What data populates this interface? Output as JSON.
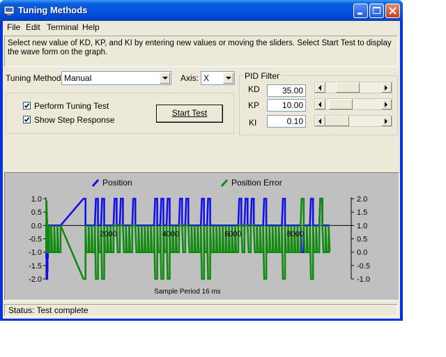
{
  "window": {
    "title": "Tuning Methods"
  },
  "menu": {
    "items": [
      "File",
      "Edit",
      "Terminal",
      "Help"
    ]
  },
  "instructions": "Select new value of KD, KP, and KI by entering new values or moving the sliders.  Select Start Test to display the wave form on the graph.",
  "tuning": {
    "method_label": "Tuning Method:",
    "method_value": "Manual",
    "axis_label": "Axis:",
    "axis_value": "X"
  },
  "test_options": {
    "perform_label": "Perform Tuning Test",
    "perform_checked": true,
    "step_label": "Show Step Response",
    "step_checked": true,
    "start_button": "Start Test"
  },
  "pid": {
    "title": "PID Filter",
    "params": [
      {
        "name": "KD",
        "value": "35.00",
        "slider_pos": 0.32
      },
      {
        "name": "KP",
        "value": "10.00",
        "slider_pos": 0.1
      },
      {
        "name": "KI",
        "value": "0.10",
        "slider_pos": 0.0
      }
    ]
  },
  "chart_data": {
    "type": "line",
    "xlabel": "Sample Period 16 ms",
    "x_ticks": [
      "2000",
      "4000",
      "6000",
      "8000"
    ],
    "xlim": [
      0,
      9300
    ],
    "left_axis": {
      "ticks": [
        "1.0",
        "0.5",
        "0.0",
        "-0.5",
        "-1.0",
        "-1.5",
        "-2.0"
      ],
      "ylim": [
        -2.0,
        1.0
      ]
    },
    "right_axis": {
      "ticks": [
        "2.0",
        "1.5",
        "1.0",
        "0.5",
        "0.0",
        "-0.5",
        "-1.0"
      ],
      "ylim": [
        -1.0,
        2.0
      ]
    },
    "legend_position": "top",
    "colors": {
      "Position": "#1010e8",
      "Position Error": "#128a12"
    },
    "series": [
      {
        "name": "Position",
        "axis": "left",
        "x": [
          0,
          10,
          20,
          30,
          40,
          50,
          60,
          70,
          80,
          90,
          95,
          100,
          200,
          300,
          400,
          1200,
          1300,
          1400,
          1500,
          1600,
          1700,
          1800,
          1900,
          2000,
          2100,
          2200,
          2300,
          2400,
          2500,
          2600,
          2700,
          2800,
          2900,
          3000,
          3100,
          3200,
          3300,
          3400,
          3500,
          3600,
          3700,
          3800,
          3900,
          4000,
          4100,
          4200,
          4300,
          4400,
          4500,
          4600,
          4700,
          4800,
          4900,
          5000,
          5100,
          5200,
          5300,
          5400,
          5500,
          5600,
          5700,
          5800,
          5900,
          6000,
          6100,
          6200,
          6300,
          6400,
          6500,
          6600,
          6700,
          6800,
          6900,
          7000,
          7100,
          7200,
          7300,
          7400,
          7500,
          7600,
          7700,
          7800,
          7900,
          8000,
          8100,
          8200,
          8300,
          8400,
          8500,
          8600,
          8700,
          8800,
          8900,
          9000,
          9100
        ],
        "y": [
          0,
          -1.2,
          -1.5,
          -2.0,
          -1.7,
          -1.2,
          -0.8,
          -0.3,
          0,
          0,
          0,
          0,
          0,
          0,
          0,
          1.0,
          0,
          0,
          0,
          1.0,
          0,
          1.0,
          0,
          0,
          0,
          1.0,
          0,
          1.0,
          0,
          0,
          0,
          1.0,
          0,
          0,
          0,
          0,
          0,
          0,
          1.0,
          0,
          1.0,
          0,
          1.0,
          0,
          0,
          0,
          1.0,
          0,
          1.0,
          0,
          0,
          0,
          0,
          1.0,
          0,
          1.0,
          0,
          0,
          0,
          0,
          0,
          0,
          0,
          0,
          0,
          1.0,
          0,
          1.0,
          0,
          1.0,
          0,
          0,
          0,
          1.0,
          0,
          0,
          0,
          0,
          0,
          1.0,
          0,
          0,
          0,
          0,
          0,
          -1.0,
          0,
          0,
          1.0,
          0,
          0,
          1.0,
          0,
          0,
          0
        ]
      },
      {
        "name": "Position Error",
        "axis": "right",
        "x": [
          0,
          10,
          20,
          30,
          40,
          50,
          60,
          70,
          80,
          90,
          95,
          100,
          200,
          300,
          400,
          1200,
          1300,
          1400,
          1500,
          1600,
          1700,
          1800,
          1900,
          2000,
          2100,
          2200,
          2300,
          2400,
          2500,
          2600,
          2700,
          2800,
          2900,
          3000,
          3100,
          3200,
          3300,
          3400,
          3500,
          3600,
          3700,
          3800,
          3900,
          4000,
          4100,
          4200,
          4300,
          4400,
          4500,
          4600,
          4700,
          4800,
          4900,
          5000,
          5100,
          5200,
          5300,
          5400,
          5500,
          5600,
          5700,
          5800,
          5900,
          6000,
          6100,
          6200,
          6300,
          6400,
          6500,
          6600,
          6700,
          6800,
          6900,
          7000,
          7100,
          7200,
          7300,
          7400,
          7500,
          7600,
          7700,
          7800,
          7900,
          8000,
          8100,
          8200,
          8300,
          8400,
          8500,
          8600,
          8700,
          8800,
          8900,
          9000,
          9100
        ],
        "y": [
          0.0,
          1.9,
          1.5,
          1.2,
          0.8,
          0.6,
          0.3,
          0.0,
          0.0,
          0.0,
          0.0,
          0.0,
          0.0,
          0.0,
          0.0,
          -1.0,
          0.0,
          0.0,
          0.0,
          -1.0,
          0.0,
          -1.0,
          0.0,
          0.0,
          0.0,
          1.0,
          0.0,
          1.0,
          0.0,
          0.0,
          0.0,
          1.0,
          0.0,
          0.0,
          0.0,
          0.0,
          0.0,
          0.0,
          -1.0,
          0.0,
          -1.0,
          0.0,
          -1.0,
          0.0,
          0.0,
          0.0,
          1.0,
          0.0,
          1.0,
          0.0,
          0.0,
          0.0,
          0.0,
          -1.0,
          0.0,
          -1.0,
          0.0,
          0.0,
          0.0,
          0.0,
          0.0,
          0.0,
          0.0,
          0.0,
          0.0,
          1.0,
          0.0,
          1.0,
          0.0,
          1.0,
          0.0,
          0.0,
          0.0,
          -1.0,
          0.0,
          0.0,
          0.0,
          0.0,
          0.0,
          -1.0,
          0.0,
          0.0,
          0.0,
          0.0,
          0.0,
          2.0,
          0.0,
          0.0,
          -1.0,
          0.0,
          0.0,
          2.0,
          0.0,
          0.0,
          0.0
        ]
      }
    ]
  },
  "status": "Status: Test complete"
}
